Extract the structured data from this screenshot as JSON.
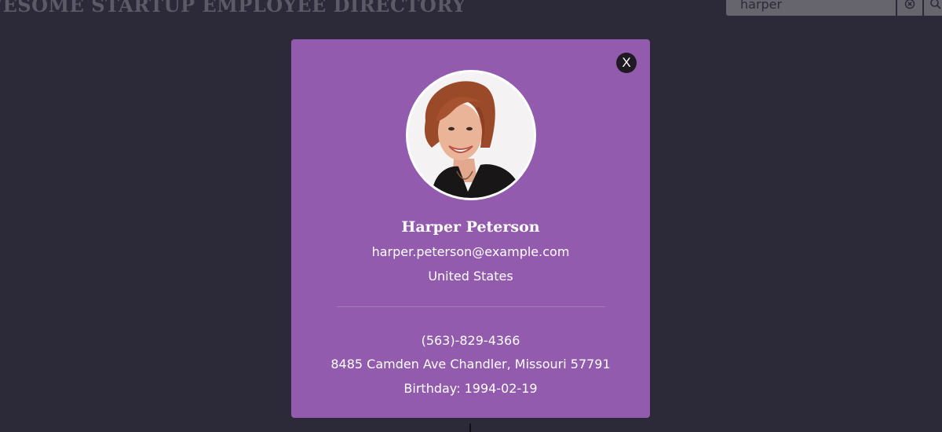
{
  "page": {
    "title": "WESOME STARTUP EMPLOYEE DIRECTORY"
  },
  "search": {
    "value": "harper",
    "clear_icon": "clear-icon",
    "submit_icon": "search-icon"
  },
  "modal": {
    "close_label": "X",
    "avatar_icon": "profile-photo",
    "name": "Harper Peterson",
    "email": "harper.peterson@example.com",
    "country": "United States",
    "phone": "(563)-829-4366",
    "address": "8485 Camden Ave Chandler, Missouri 57791",
    "birthday": "Birthday: 1994-02-19"
  },
  "colors": {
    "backdrop": "#2c2a38",
    "modal_bg": "#925bae",
    "close_button": "#1f1a22",
    "text": "#ffffff"
  }
}
